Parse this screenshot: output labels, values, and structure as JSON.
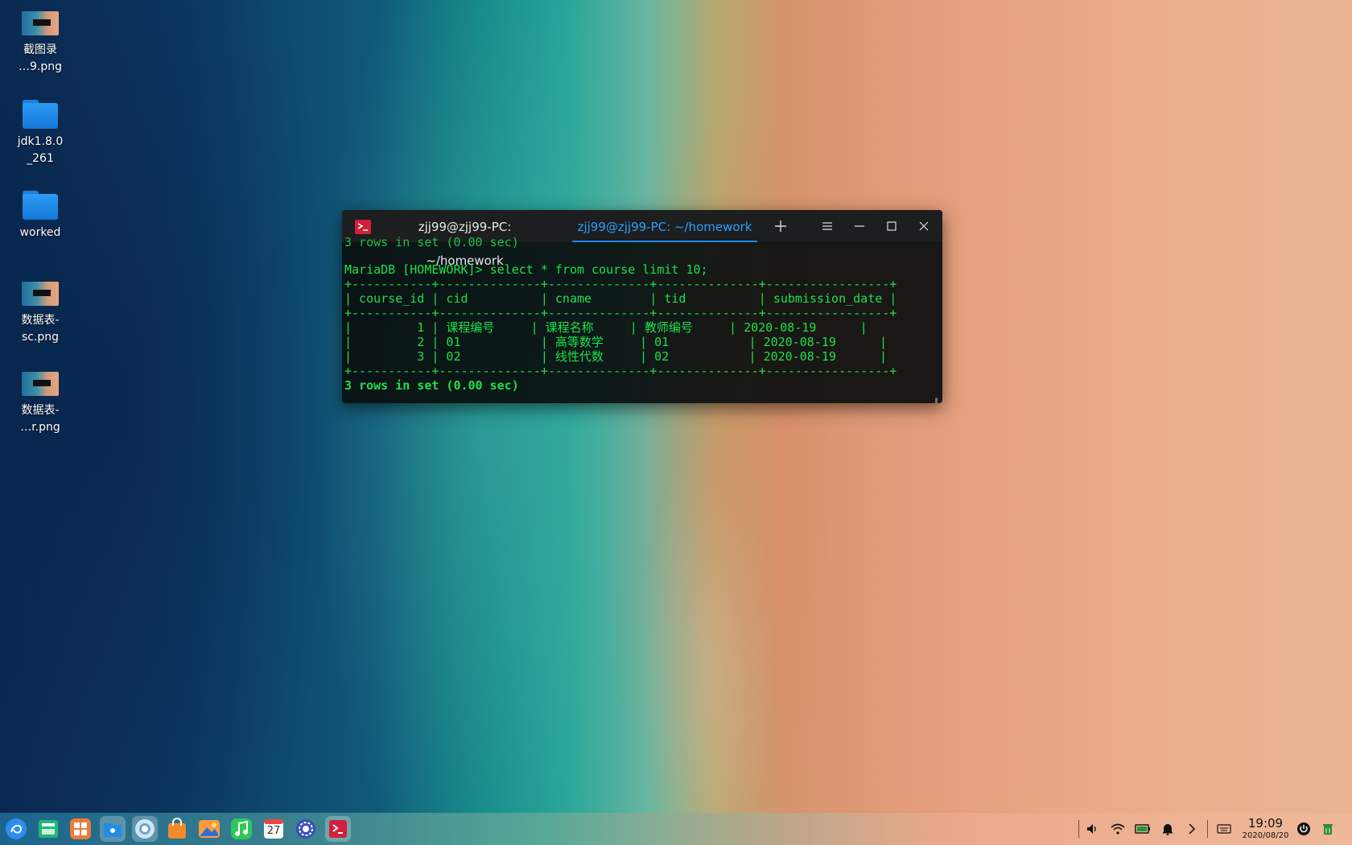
{
  "desktop": {
    "icons": [
      {
        "label": "截图录\n…9.png",
        "icon": "image-thumbnail-icon"
      },
      {
        "label": "jdk1.8.0\n_261",
        "icon": "folder-icon"
      },
      {
        "label": "worked",
        "icon": "folder-icon"
      },
      {
        "label": "数据表-\nsc.png",
        "icon": "image-thumbnail-icon"
      },
      {
        "label": "数据表-\n…r.png",
        "icon": "image-thumbnail-icon"
      }
    ]
  },
  "terminal": {
    "tabs": [
      {
        "label": "zjj99@zjj99-PC: ~/homework",
        "active": false
      },
      {
        "label": "zjj99@zjj99-PC: ~/homework",
        "active": true
      }
    ],
    "lines": [
      "3 rows in set (0.00 sec)",
      "MariaDB [HOMEWORK]> select * from course limit 10;",
      "+-----------+--------------+--------------+--------------+-----------------+",
      "| course_id | cid          | cname        | tid          | submission_date |",
      "+-----------+--------------+--------------+--------------+-----------------+",
      "|         1 | 课程编号     | 课程名称     | 教师编号     | 2020-08-19      |",
      "|         2 | 01           | 高等数学     | 01           | 2020-08-19      |",
      "|         3 | 02           | 线性代数     | 02           | 2020-08-19      |",
      "+-----------+--------------+--------------+--------------+-----------------+",
      "3 rows in set (0.00 sec)"
    ],
    "text_color": "#1ee04a",
    "tab_active_color": "#2c9fff"
  },
  "taskbar": {
    "dock": [
      "launcher-icon",
      "multitask-view-icon",
      "app-store-icon",
      "file-manager-icon",
      "browser-icon",
      "store-bag-icon",
      "photos-icon",
      "music-icon",
      "calendar-icon",
      "settings-icon",
      "terminal-icon"
    ],
    "calendar_day": "27",
    "clock": {
      "time": "19:09",
      "date": "2020/08/20"
    }
  }
}
